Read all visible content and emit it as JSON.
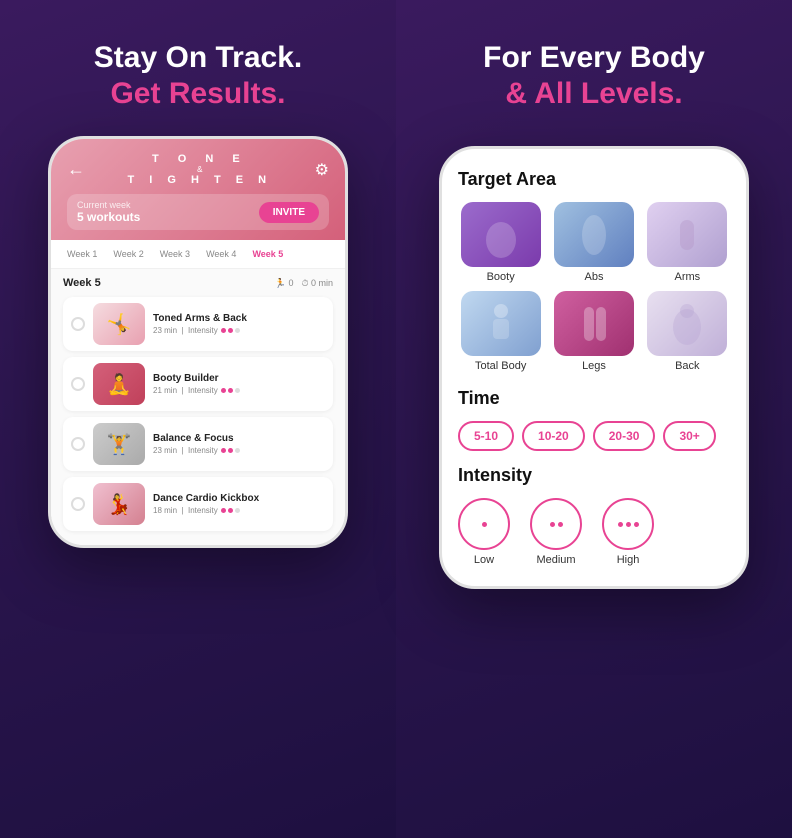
{
  "left": {
    "headline_white": "Stay On Track.",
    "headline_pink": "Get Results.",
    "app": {
      "tone": "T O N E",
      "amp": "&",
      "tighten": "T I G H T E N"
    },
    "current_week_label": "Current week",
    "workout_count": "5 workouts",
    "invite_btn": "INVITE",
    "week_tabs": [
      "Week 1",
      "Week 2",
      "Week 3",
      "Week 4",
      "Week 5"
    ],
    "active_week": "Week 5",
    "week_title": "Week 5",
    "stats_exercises": "0",
    "stats_min": "0 min",
    "workouts": [
      {
        "name": "Toned Arms & Back",
        "duration": "23 min",
        "intensity_label": "Intensity",
        "dots_filled": 2,
        "dots_empty": 1,
        "thumb_class": "workout-thumb-toned"
      },
      {
        "name": "Booty Builder",
        "duration": "21 min",
        "intensity_label": "Intensity",
        "dots_filled": 2,
        "dots_empty": 1,
        "thumb_class": "workout-thumb-booty"
      },
      {
        "name": "Balance & Focus",
        "duration": "23 min",
        "intensity_label": "Intensity",
        "dots_filled": 2,
        "dots_empty": 1,
        "thumb_class": "workout-thumb-balance"
      },
      {
        "name": "Dance Cardio Kickbox",
        "duration": "18 min",
        "intensity_label": "Intensity",
        "dots_filled": 2,
        "dots_empty": 1,
        "thumb_class": "workout-thumb-dance"
      }
    ]
  },
  "right": {
    "headline_white": "For Every Body",
    "headline_pink": "& All Levels.",
    "target_area_title": "Target Area",
    "targets": [
      {
        "label": "Booty",
        "thumb_class": "thumb-booty"
      },
      {
        "label": "Abs",
        "thumb_class": "thumb-abs"
      },
      {
        "label": "Arms",
        "thumb_class": "thumb-arms"
      },
      {
        "label": "Total Body",
        "thumb_class": "thumb-total"
      },
      {
        "label": "Legs",
        "thumb_class": "thumb-legs"
      },
      {
        "label": "Back",
        "thumb_class": "thumb-back"
      }
    ],
    "time_title": "Time",
    "time_options": [
      "5-10",
      "10-20",
      "20-30",
      "30+"
    ],
    "intensity_title": "Intensity",
    "intensity_options": [
      {
        "label": "Low",
        "dots": 1
      },
      {
        "label": "Medium",
        "dots": 2
      },
      {
        "label": "High",
        "dots": 3
      }
    ]
  }
}
